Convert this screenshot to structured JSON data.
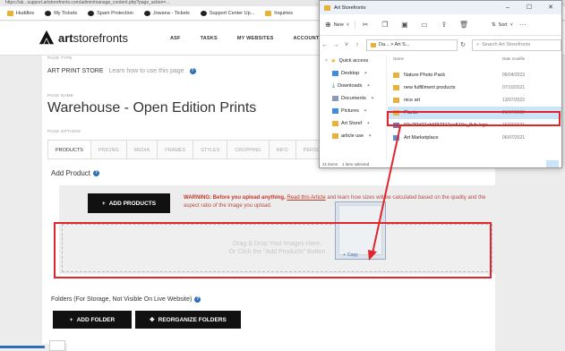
{
  "browser": {
    "url": "https://ak...support.artstorefronts.com/admin/manage_content.php?page_action=...",
    "bookmarks": [
      "Huddles",
      "My Tickets",
      "Spam Protection",
      "Jowana - Tickets",
      "Support Center Up...",
      "Inquiries"
    ]
  },
  "site": {
    "logo_bold": "art",
    "logo_rest": "storefronts",
    "nav": [
      "ASF",
      "TASKS",
      "MY WEBSITES",
      "ACCOUNT"
    ]
  },
  "page": {
    "page_type_label": "PAGE TYPE",
    "page_type_value": "ART PRINT STORE",
    "page_type_help": "Learn how to use this page",
    "page_name_label": "PAGE NAME",
    "page_name_value": "Warehouse - Open Edition Prints",
    "page_options_label": "PAGE OPTIONS",
    "tabs": [
      "PRODUCTS",
      "PRICING",
      "MEDIA",
      "FRAMES",
      "STYLES",
      "CROPPING",
      "INFO",
      "PERSONALIZE"
    ],
    "add_product_label": "Add Product",
    "add_products_button": "ADD PRODUCTS",
    "warning_bold": "WARNING: Before you upload anything,",
    "warning_link": "Read this Article",
    "warning_rest": "and learn how sizes will be calculated based on the quality and the aspect ratio of the image you upload.",
    "dropzone_line1": "Drag & Drop Your Images Here,",
    "dropzone_line2": "Or Click the \"Add Products\" Button",
    "folders_label": "Folders (For Storage, Not Visible On Live Website)",
    "add_folder_button": "ADD FOLDER",
    "reorganize_button": "REORGANIZE FOLDERS"
  },
  "explorer": {
    "title": "Art Storefronts",
    "toolbar_new": "New",
    "toolbar_sort": "Sort",
    "address": "Da... > Art S...",
    "search_placeholder": "Search Art Storefronts",
    "nav_items": [
      {
        "label": "Quick access",
        "icon": "star"
      },
      {
        "label": "Desktop",
        "icon": "desktop"
      },
      {
        "label": "Downloads",
        "icon": "download"
      },
      {
        "label": "Documents",
        "icon": "documents"
      },
      {
        "label": "Pictures",
        "icon": "pictures"
      },
      {
        "label": "Art Storef",
        "icon": "folder"
      },
      {
        "label": "article use",
        "icon": "folder"
      }
    ],
    "col_name": "Name",
    "col_date": "Date modifie",
    "files": [
      {
        "name": "Nature Photo Pack",
        "date": "05/04/2023",
        "type": "folder"
      },
      {
        "name": "new fulfillment products",
        "date": "07/10/2021",
        "type": "folder"
      },
      {
        "name": "nice art",
        "date": "13/07/2022",
        "type": "folder"
      },
      {
        "name": "Plants",
        "date": "21/07/2022",
        "type": "folder",
        "selected": true
      },
      {
        "name": "60c2f2d21eb6f37312ae510e_flub logo",
        "date": "15/07/2021",
        "type": "image"
      },
      {
        "name": "Art Marketplace",
        "date": "06/07/2021",
        "type": "doc"
      }
    ],
    "status_items": "21 items",
    "status_selected": "1 item selected"
  },
  "drag": {
    "copy_label": "Copy"
  },
  "colors": {
    "annotation": "#e0262c",
    "brand_blue": "#2c6fb7",
    "warning": "#c0392b"
  }
}
